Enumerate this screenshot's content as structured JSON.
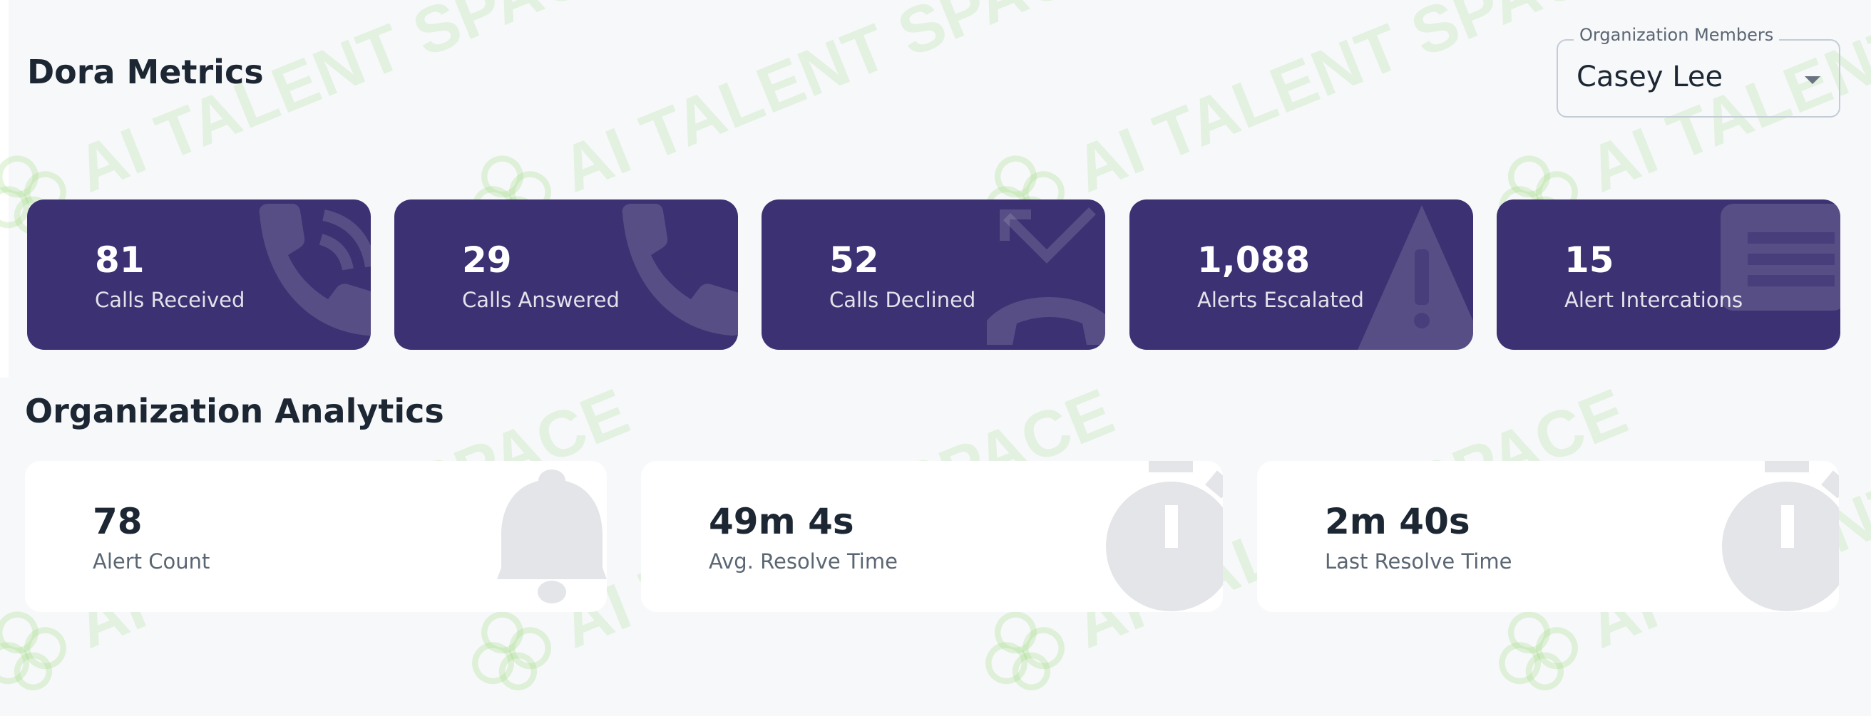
{
  "page": {
    "title": "Dora Metrics",
    "section_title": "Organization Analytics",
    "watermark_text": "AI TALENT SPACE"
  },
  "member_select": {
    "label": "Organization Members",
    "value": "Casey Lee"
  },
  "metrics": [
    {
      "value": "81",
      "label": "Calls Received",
      "icon": "phone-ringing-icon"
    },
    {
      "value": "29",
      "label": "Calls Answered",
      "icon": "phone-icon"
    },
    {
      "value": "52",
      "label": "Calls Declined",
      "icon": "missed-call-icon"
    },
    {
      "value": "1,088",
      "label": "Alerts Escalated",
      "icon": "warning-icon"
    },
    {
      "value": "15",
      "label": "Alert Intercations",
      "icon": "list-icon"
    }
  ],
  "analytics": [
    {
      "value": "78",
      "label": "Alert Count",
      "icon": "bell-icon"
    },
    {
      "value": "49m 4s",
      "label": "Avg. Resolve Time",
      "icon": "stopwatch-icon"
    },
    {
      "value": "2m 40s",
      "label": "Last Resolve Time",
      "icon": "stopwatch-icon"
    }
  ],
  "colors": {
    "metric_card": "#3c3172",
    "background": "#f7f8fa",
    "watermark": "#96d778"
  }
}
